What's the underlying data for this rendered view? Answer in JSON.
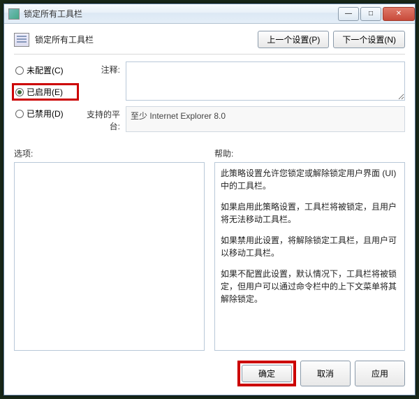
{
  "window": {
    "title": "锁定所有工具栏"
  },
  "header": {
    "page_title": "锁定所有工具栏",
    "prev_btn": "上一个设置(P)",
    "next_btn": "下一个设置(N)"
  },
  "radios": {
    "not_configured": "未配置(C)",
    "enabled": "已启用(E)",
    "disabled": "已禁用(D)",
    "selected": "enabled"
  },
  "fields": {
    "comment_label": "注释:",
    "comment_value": "",
    "platform_label": "支持的平台:",
    "platform_value": "至少 Internet Explorer 8.0"
  },
  "lower": {
    "options_label": "选项:",
    "help_label": "帮助:",
    "help_paragraphs": [
      "此策略设置允许您锁定或解除锁定用户界面 (UI) 中的工具栏。",
      "如果启用此策略设置，工具栏将被锁定，且用户将无法移动工具栏。",
      "如果禁用此设置，将解除锁定工具栏，且用户可以移动工具栏。",
      "如果不配置此设置，默认情况下，工具栏将被锁定，但用户可以通过命令栏中的上下文菜单将其解除锁定。"
    ]
  },
  "footer": {
    "ok": "确定",
    "cancel": "取消",
    "apply": "应用"
  }
}
